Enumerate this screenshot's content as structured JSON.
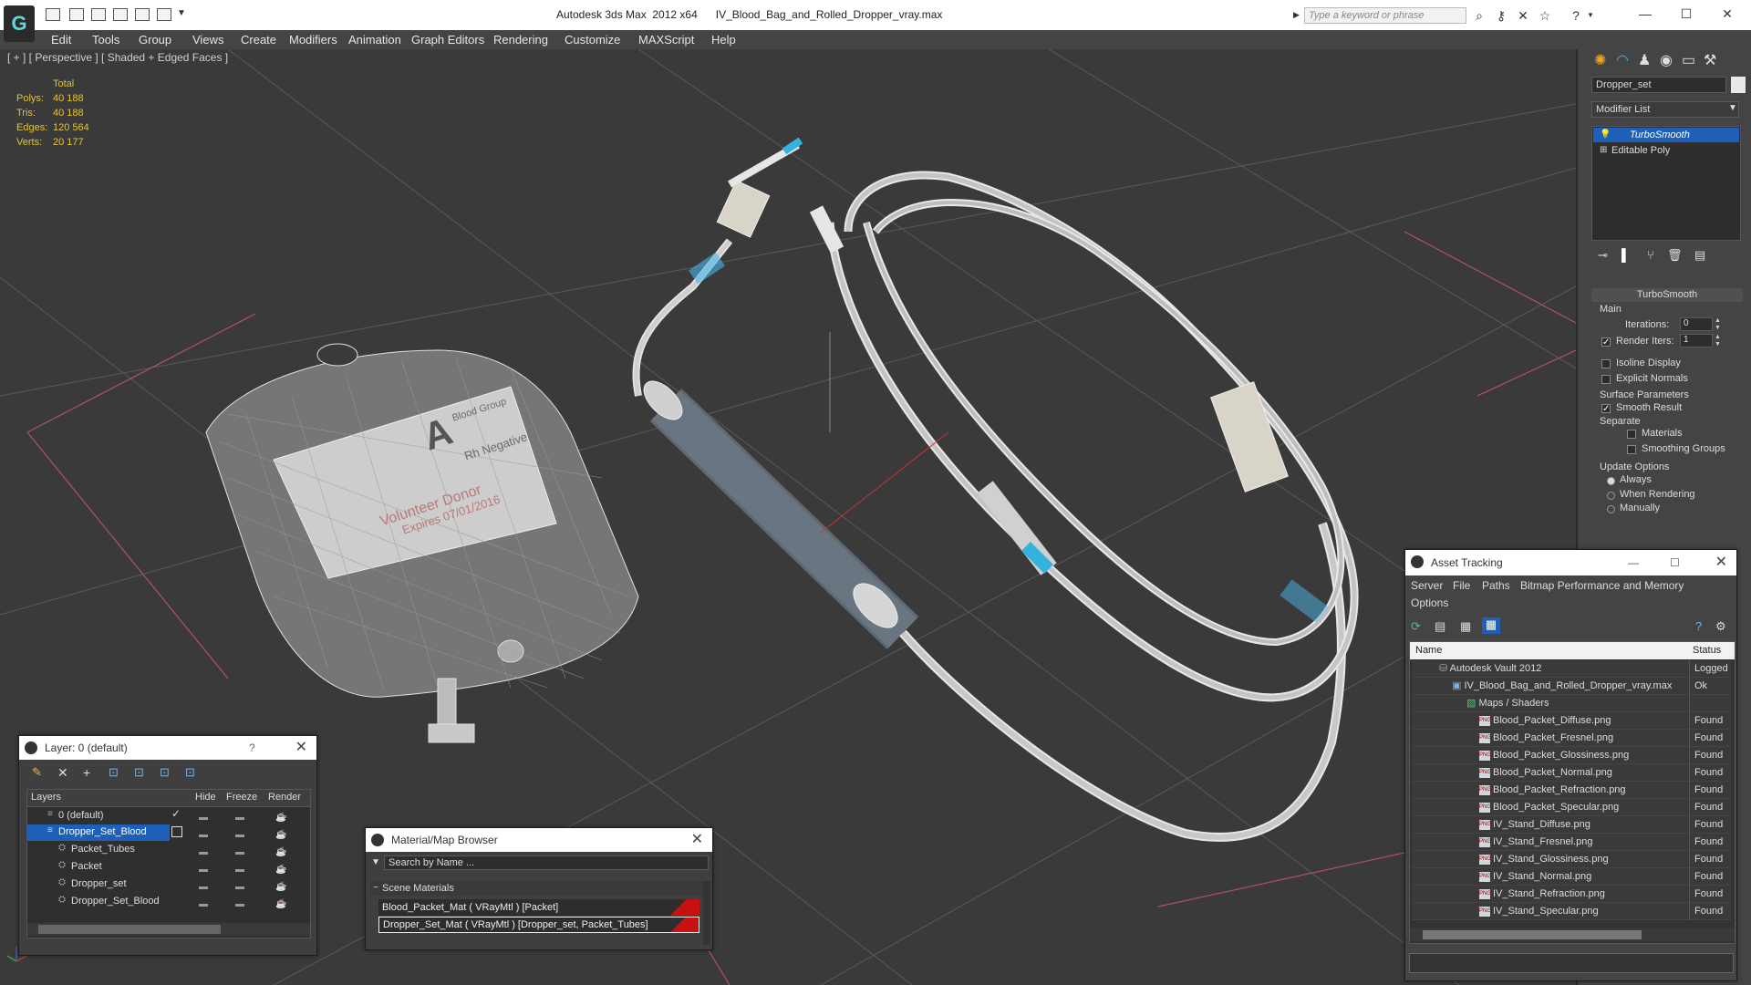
{
  "titlebar": {
    "title": "Autodesk 3ds Max  2012 x64      IV_Blood_Bag_and_Rolled_Dropper_vray.max",
    "search_placeholder": "Type a keyword or phrase"
  },
  "menu": [
    "Edit",
    "Tools",
    "Group",
    "Views",
    "Create",
    "Modifiers",
    "Animation",
    "Graph Editors",
    "Rendering",
    "Customize",
    "MAXScript",
    "Help"
  ],
  "viewport": {
    "label": "[ + ] [ Perspective ] [ Shaded + Edged Faces ]",
    "stats": {
      "header": "Total",
      "rows": [
        {
          "label": "Polys:",
          "value": "40 188"
        },
        {
          "label": "Tris:",
          "value": "40 188"
        },
        {
          "label": "Edges:",
          "value": "120 564"
        },
        {
          "label": "Verts:",
          "value": "20 177"
        }
      ]
    },
    "bag_labels": {
      "blood_group_title": "Blood Group",
      "blood_type": "A",
      "rh": "Rh Negative",
      "donor": "Volunteer Donor",
      "expires": "Expires 07/01/2016"
    }
  },
  "command_panel": {
    "object_name": "Dropper_set",
    "modifier_list": "Modifier List",
    "stack": [
      "TurboSmooth",
      "Editable Poly"
    ],
    "rollout_title": "TurboSmooth",
    "main_label": "Main",
    "iterations_label": "Iterations:",
    "iterations_value": "0",
    "render_iters_label": "Render Iters:",
    "render_iters_value": "1",
    "isoline_label": "Isoline Display",
    "explicit_normals_label": "Explicit Normals",
    "surface_params_label": "Surface Parameters",
    "smooth_result_label": "Smooth Result",
    "separate_label": "Separate",
    "materials_label": "Materials",
    "smoothing_groups_label": "Smoothing Groups",
    "update_options_label": "Update Options",
    "always_label": "Always",
    "when_rendering_label": "When Rendering",
    "manually_label": "Manually"
  },
  "layer_panel": {
    "title": "Layer: 0 (default)",
    "help": "?",
    "columns": [
      "Layers",
      "Hide",
      "Freeze",
      "Render"
    ],
    "rows": [
      "0 (default)",
      "Dropper_Set_Blood",
      "Packet_Tubes",
      "Packet",
      "Dropper_set",
      "Dropper_Set_Blood"
    ]
  },
  "material_browser": {
    "title": "Material/Map Browser",
    "search_placeholder": "Search by Name ...",
    "section": "Scene Materials",
    "items": [
      "Blood_Packet_Mat  ( VRayMtl )  [Packet]",
      "Dropper_Set_Mat  ( VRayMtl )  [Dropper_set, Packet_Tubes]"
    ]
  },
  "asset_tracking": {
    "title": "Asset Tracking",
    "menu": [
      "Server",
      "File",
      "Paths",
      "Bitmap Performance and Memory",
      "Options"
    ],
    "columns": [
      "Name",
      "Status"
    ],
    "rows": [
      {
        "name": "Autodesk Vault 2012",
        "status": "Logged O"
      },
      {
        "name": "IV_Blood_Bag_and_Rolled_Dropper_vray.max",
        "status": "Ok"
      },
      {
        "name": "Maps / Shaders",
        "status": ""
      },
      {
        "name": "Blood_Packet_Diffuse.png",
        "status": "Found"
      },
      {
        "name": "Blood_Packet_Fresnel.png",
        "status": "Found"
      },
      {
        "name": "Blood_Packet_Glossiness.png",
        "status": "Found"
      },
      {
        "name": "Blood_Packet_Normal.png",
        "status": "Found"
      },
      {
        "name": "Blood_Packet_Refraction.png",
        "status": "Found"
      },
      {
        "name": "Blood_Packet_Specular.png",
        "status": "Found"
      },
      {
        "name": "IV_Stand_Diffuse.png",
        "status": "Found"
      },
      {
        "name": "IV_Stand_Fresnel.png",
        "status": "Found"
      },
      {
        "name": "IV_Stand_Glossiness.png",
        "status": "Found"
      },
      {
        "name": "IV_Stand_Normal.png",
        "status": "Found"
      },
      {
        "name": "IV_Stand_Refraction.png",
        "status": "Found"
      },
      {
        "name": "IV_Stand_Specular.png",
        "status": "Found"
      }
    ]
  },
  "colors": {
    "selection": "#1e5fb8",
    "stats": "#e5c33a",
    "found_icon": "#cfd8df",
    "grid": "#c0507a"
  }
}
